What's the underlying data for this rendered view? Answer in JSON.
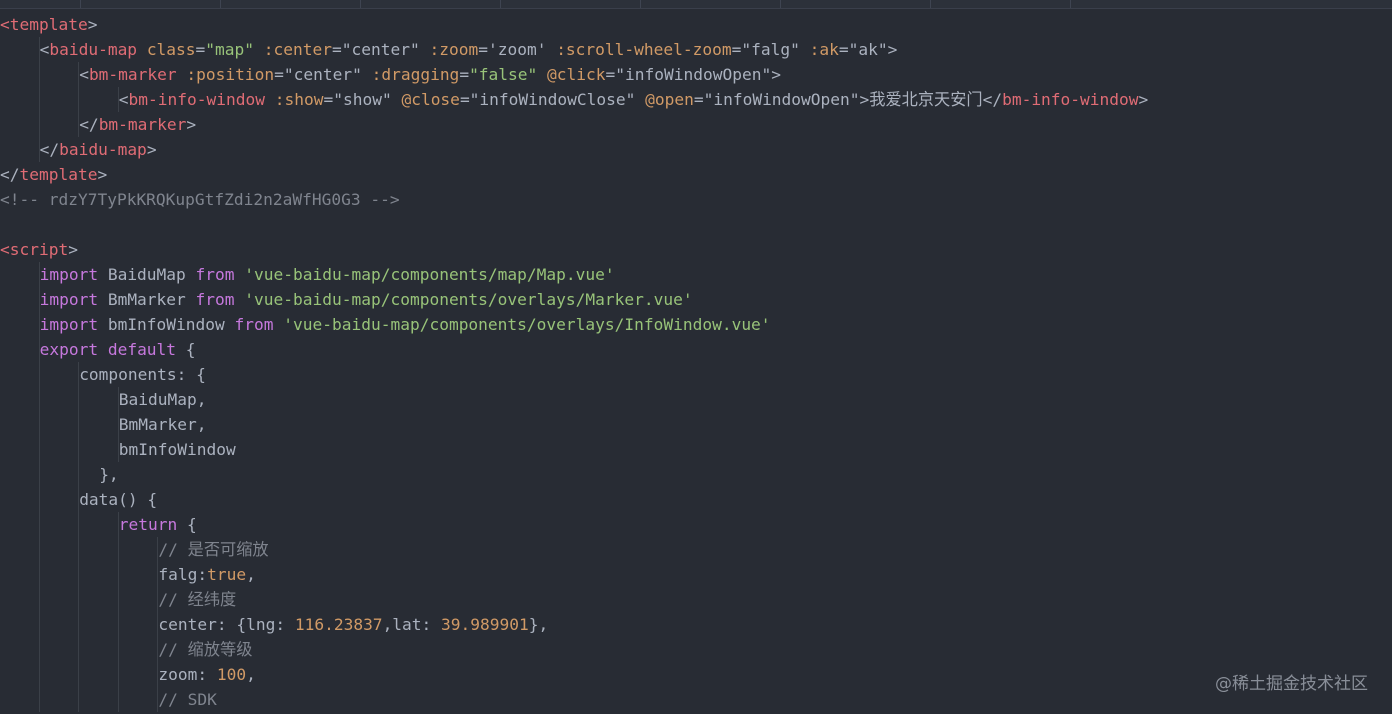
{
  "colors": {
    "background": "#282c34",
    "tag": "#e06c75",
    "attribute": "#d19a66",
    "string": "#98c379",
    "keyword": "#c678dd",
    "comment": "#7f848e",
    "number": "#d19a66",
    "plain": "#abb2bf"
  },
  "code_lines": [
    {
      "indent": 0,
      "tokens": [
        {
          "t": "tag",
          "v": "<template"
        },
        {
          "t": "plain",
          "v": ">"
        }
      ]
    },
    {
      "indent": 1,
      "tokens": [
        {
          "t": "plain",
          "v": "<"
        },
        {
          "t": "tag",
          "v": "baidu-map"
        },
        {
          "t": "plain",
          "v": " "
        },
        {
          "t": "attr",
          "v": "class"
        },
        {
          "t": "plain",
          "v": "="
        },
        {
          "t": "str",
          "v": "\"map\""
        },
        {
          "t": "plain",
          "v": " "
        },
        {
          "t": "attr",
          "v": ":center"
        },
        {
          "t": "plain",
          "v": "=\"center\" "
        },
        {
          "t": "attr",
          "v": ":zoom"
        },
        {
          "t": "plain",
          "v": "='zoom' "
        },
        {
          "t": "attr",
          "v": ":scroll-wheel-zoom"
        },
        {
          "t": "plain",
          "v": "=\"falg\" "
        },
        {
          "t": "attr",
          "v": ":ak"
        },
        {
          "t": "plain",
          "v": "=\"ak\">"
        }
      ]
    },
    {
      "indent": 2,
      "tokens": [
        {
          "t": "plain",
          "v": "<"
        },
        {
          "t": "tag",
          "v": "bm-marker"
        },
        {
          "t": "plain",
          "v": " "
        },
        {
          "t": "attr",
          "v": ":position"
        },
        {
          "t": "plain",
          "v": "=\"center\" "
        },
        {
          "t": "attr",
          "v": ":dragging"
        },
        {
          "t": "plain",
          "v": "="
        },
        {
          "t": "str",
          "v": "\"false\""
        },
        {
          "t": "plain",
          "v": " "
        },
        {
          "t": "attr",
          "v": "@click"
        },
        {
          "t": "plain",
          "v": "=\"infoWindowOpen\">"
        }
      ]
    },
    {
      "indent": 3,
      "tokens": [
        {
          "t": "plain",
          "v": "<"
        },
        {
          "t": "tag",
          "v": "bm-info-window"
        },
        {
          "t": "plain",
          "v": " "
        },
        {
          "t": "attr",
          "v": ":show"
        },
        {
          "t": "plain",
          "v": "=\"show\" "
        },
        {
          "t": "attr",
          "v": "@close"
        },
        {
          "t": "plain",
          "v": "=\"infoWindowClose\" "
        },
        {
          "t": "attr",
          "v": "@open"
        },
        {
          "t": "plain",
          "v": "=\"infoWindowOpen\">我爱北京天安门</"
        },
        {
          "t": "tag",
          "v": "bm-info-window"
        },
        {
          "t": "plain",
          "v": ">"
        }
      ]
    },
    {
      "indent": 2,
      "tokens": [
        {
          "t": "plain",
          "v": "</"
        },
        {
          "t": "tag",
          "v": "bm-marker"
        },
        {
          "t": "plain",
          "v": ">"
        }
      ]
    },
    {
      "indent": 1,
      "tokens": [
        {
          "t": "plain",
          "v": "</"
        },
        {
          "t": "tag",
          "v": "baidu-map"
        },
        {
          "t": "plain",
          "v": ">"
        }
      ]
    },
    {
      "indent": 0,
      "tokens": [
        {
          "t": "plain",
          "v": "</"
        },
        {
          "t": "tag",
          "v": "template"
        },
        {
          "t": "plain",
          "v": ">"
        }
      ]
    },
    {
      "indent": 0,
      "tokens": [
        {
          "t": "com",
          "v": "<!-- rdzY7TyPkKRQKupGtfZdi2n2aWfHG0G3 -->"
        }
      ]
    },
    {
      "indent": 0,
      "tokens": []
    },
    {
      "indent": 0,
      "tokens": [
        {
          "t": "tag",
          "v": "<script"
        },
        {
          "t": "plain",
          "v": ">"
        }
      ]
    },
    {
      "indent": 1,
      "tokens": [
        {
          "t": "kw",
          "v": "import"
        },
        {
          "t": "plain",
          "v": " BaiduMap "
        },
        {
          "t": "kw",
          "v": "from"
        },
        {
          "t": "plain",
          "v": " "
        },
        {
          "t": "str",
          "v": "'vue-baidu-map/components/map/Map.vue'"
        }
      ]
    },
    {
      "indent": 1,
      "tokens": [
        {
          "t": "kw",
          "v": "import"
        },
        {
          "t": "plain",
          "v": " BmMarker "
        },
        {
          "t": "kw",
          "v": "from"
        },
        {
          "t": "plain",
          "v": " "
        },
        {
          "t": "str",
          "v": "'vue-baidu-map/components/overlays/Marker.vue'"
        }
      ]
    },
    {
      "indent": 1,
      "tokens": [
        {
          "t": "kw",
          "v": "import"
        },
        {
          "t": "plain",
          "v": " bmInfoWindow "
        },
        {
          "t": "kw",
          "v": "from"
        },
        {
          "t": "plain",
          "v": " "
        },
        {
          "t": "str",
          "v": "'vue-baidu-map/components/overlays/InfoWindow.vue'"
        }
      ]
    },
    {
      "indent": 1,
      "tokens": [
        {
          "t": "kw",
          "v": "export"
        },
        {
          "t": "plain",
          "v": " "
        },
        {
          "t": "kw",
          "v": "default"
        },
        {
          "t": "plain",
          "v": " {"
        }
      ]
    },
    {
      "indent": 2,
      "tokens": [
        {
          "t": "plain",
          "v": "components: {"
        }
      ]
    },
    {
      "indent": 3,
      "tokens": [
        {
          "t": "plain",
          "v": "BaiduMap,"
        }
      ]
    },
    {
      "indent": 3,
      "tokens": [
        {
          "t": "plain",
          "v": "BmMarker,"
        }
      ]
    },
    {
      "indent": 3,
      "tokens": [
        {
          "t": "plain",
          "v": "bmInfoWindow"
        }
      ]
    },
    {
      "indent": 2,
      "extra": 2,
      "tokens": [
        {
          "t": "plain",
          "v": "},"
        }
      ]
    },
    {
      "indent": 2,
      "tokens": [
        {
          "t": "plain",
          "v": "data() {"
        }
      ]
    },
    {
      "indent": 3,
      "tokens": [
        {
          "t": "kw",
          "v": "return"
        },
        {
          "t": "plain",
          "v": " {"
        }
      ]
    },
    {
      "indent": 4,
      "tokens": [
        {
          "t": "com",
          "v": "// 是否可缩放"
        }
      ]
    },
    {
      "indent": 4,
      "tokens": [
        {
          "t": "plain",
          "v": "falg:"
        },
        {
          "t": "num",
          "v": "true"
        },
        {
          "t": "plain",
          "v": ","
        }
      ]
    },
    {
      "indent": 4,
      "tokens": [
        {
          "t": "com",
          "v": "// 经纬度"
        }
      ]
    },
    {
      "indent": 4,
      "tokens": [
        {
          "t": "plain",
          "v": "center: {lng: "
        },
        {
          "t": "num",
          "v": "116.23837"
        },
        {
          "t": "plain",
          "v": ",lat: "
        },
        {
          "t": "num",
          "v": "39.989901"
        },
        {
          "t": "plain",
          "v": "},"
        }
      ]
    },
    {
      "indent": 4,
      "tokens": [
        {
          "t": "com",
          "v": "// 缩放等级"
        }
      ]
    },
    {
      "indent": 4,
      "tokens": [
        {
          "t": "plain",
          "v": "zoom: "
        },
        {
          "t": "num",
          "v": "100"
        },
        {
          "t": "plain",
          "v": ","
        }
      ]
    },
    {
      "indent": 4,
      "tokens": [
        {
          "t": "com",
          "v": "// SDK"
        }
      ]
    }
  ],
  "watermark": "@稀土掘金技术社区"
}
